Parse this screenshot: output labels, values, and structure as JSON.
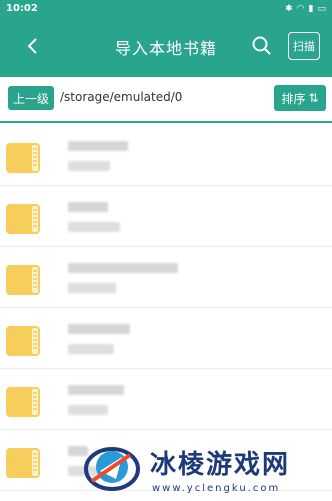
{
  "status": {
    "time": "10:02"
  },
  "header": {
    "title": "导入本地书籍",
    "scan_label": "扫描"
  },
  "path_bar": {
    "up_label": "上一级",
    "path": "/storage/emulated/0",
    "sort_label": "排序"
  },
  "watermark": {
    "text": "冰棱游戏网",
    "url": "www.yclengku.com"
  },
  "colors": {
    "accent": "#2aa58d",
    "folder": "#f7ce5b"
  },
  "rows": [
    {
      "name": "",
      "detail": ""
    },
    {
      "name": "",
      "detail": ""
    },
    {
      "name": "",
      "detail": ""
    },
    {
      "name": "",
      "detail": ""
    },
    {
      "name": "",
      "detail": ""
    },
    {
      "name": "",
      "detail": ""
    }
  ]
}
